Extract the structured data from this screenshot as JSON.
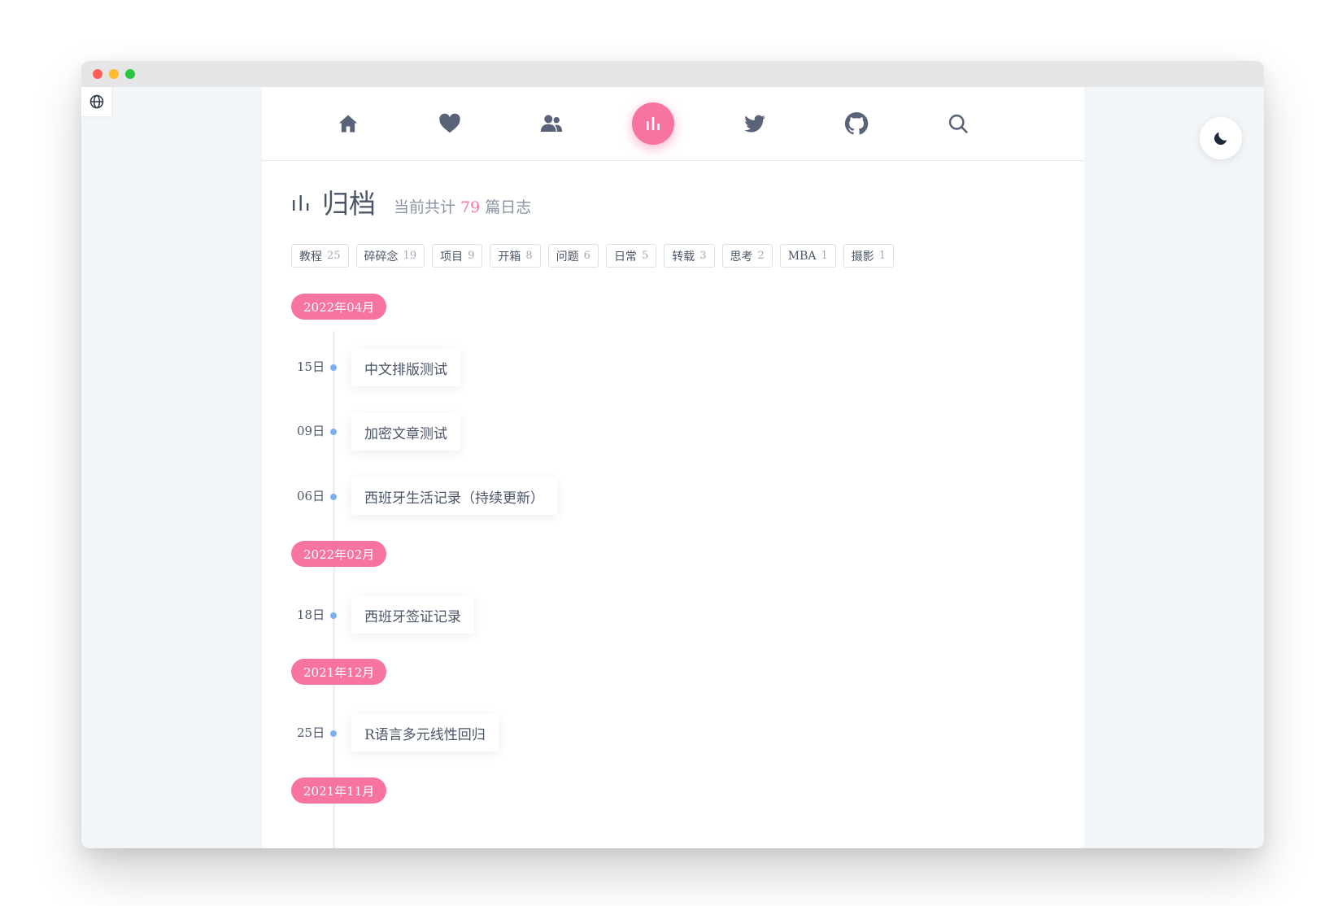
{
  "nav": {
    "items": [
      {
        "icon": "home-icon",
        "active": false
      },
      {
        "icon": "heart-icon",
        "active": false
      },
      {
        "icon": "users-icon",
        "active": false
      },
      {
        "icon": "archive-chart-icon",
        "active": true
      },
      {
        "icon": "twitter-icon",
        "active": false
      },
      {
        "icon": "github-icon",
        "active": false
      },
      {
        "icon": "search-icon",
        "active": false
      }
    ]
  },
  "archive": {
    "title": "归档",
    "summary_prefix": "当前共计",
    "total": "79",
    "summary_suffix": "篇日志"
  },
  "tags": [
    {
      "name": "教程",
      "count": "25"
    },
    {
      "name": "碎碎念",
      "count": "19"
    },
    {
      "name": "项目",
      "count": "9"
    },
    {
      "name": "开箱",
      "count": "8"
    },
    {
      "name": "问题",
      "count": "6"
    },
    {
      "name": "日常",
      "count": "5"
    },
    {
      "name": "转载",
      "count": "3"
    },
    {
      "name": "思考",
      "count": "2"
    },
    {
      "name": "MBA",
      "count": "1"
    },
    {
      "name": "摄影",
      "count": "1"
    }
  ],
  "timeline": {
    "months": [
      "2022年04月",
      "2022年02月",
      "2021年12月",
      "2021年11月"
    ],
    "posts": [
      {
        "day": "15日",
        "title": "中文排版测试"
      },
      {
        "day": "09日",
        "title": "加密文章测试"
      },
      {
        "day": "06日",
        "title": "西班牙生活记录（持续更新）"
      },
      {
        "day": "18日",
        "title": "西班牙签证记录"
      },
      {
        "day": "25日",
        "title": "R语言多元线性回归"
      }
    ]
  },
  "colors": {
    "accent": "#f773a2",
    "bullet": "#7fb0f0",
    "text": "#4a5568"
  }
}
